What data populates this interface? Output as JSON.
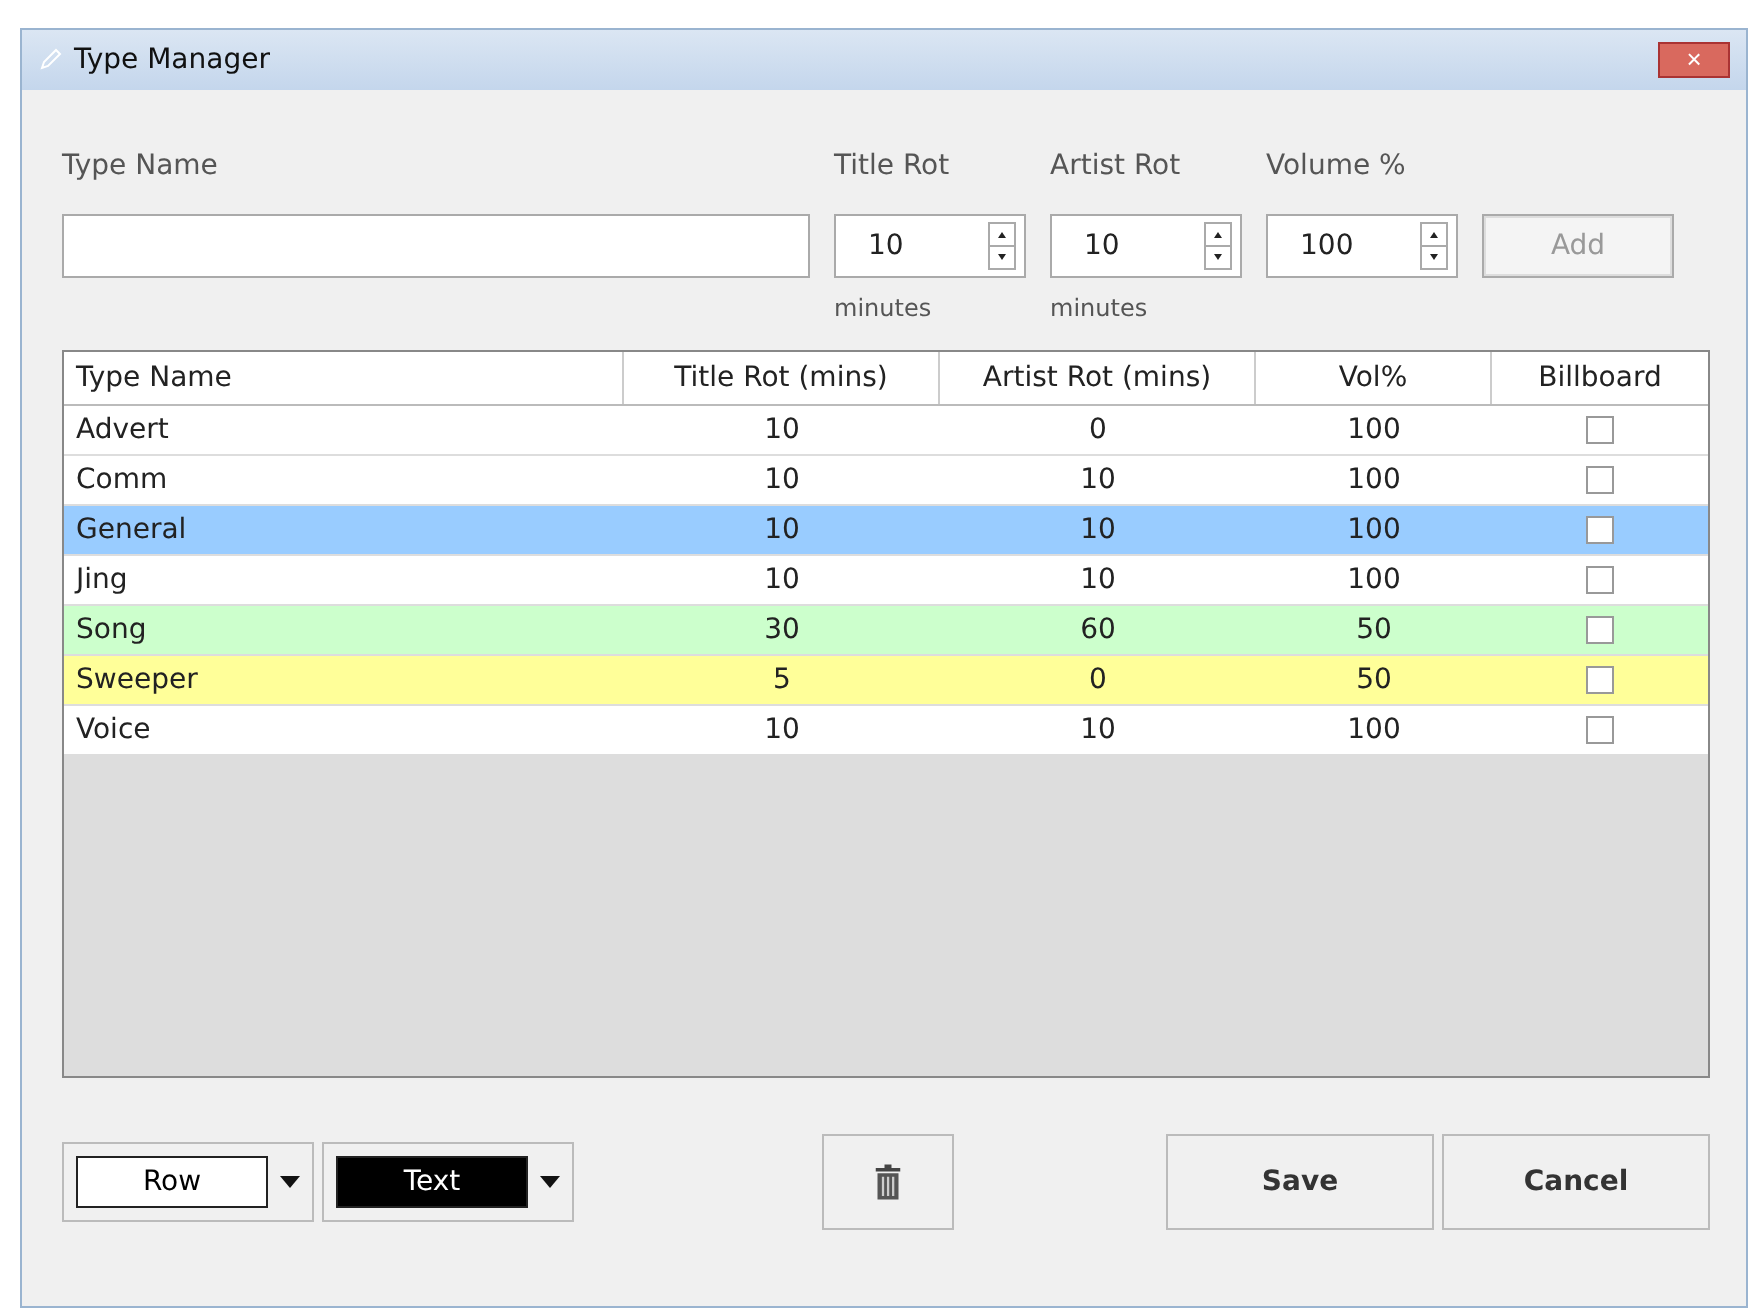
{
  "window": {
    "title": "Type Manager",
    "close": "×"
  },
  "form": {
    "type_name_label": "Type Name",
    "spinners": [
      {
        "label": "Title Rot",
        "value": "10",
        "unit": "minutes"
      },
      {
        "label": "Artist Rot",
        "value": "10",
        "unit": "minutes"
      },
      {
        "label": "Volume %",
        "value": "100"
      }
    ],
    "add_button": {
      "label": "Add",
      "disabled": true
    }
  },
  "table": {
    "columns": [
      "Type Name",
      "Title Rot (mins)",
      "Artist Rot (mins)",
      "Vol%",
      "Billboard"
    ],
    "rows": [
      {
        "name": "Advert",
        "title_rot": "10",
        "artist_rot": "0",
        "vol": "100",
        "billboard": false,
        "color": "#ffffff"
      },
      {
        "name": "Comm",
        "title_rot": "10",
        "artist_rot": "10",
        "vol": "100",
        "billboard": false,
        "color": "#ffffff"
      },
      {
        "name": "General",
        "title_rot": "10",
        "artist_rot": "10",
        "vol": "100",
        "billboard": false,
        "color": "#99ccff"
      },
      {
        "name": "Jing",
        "title_rot": "10",
        "artist_rot": "10",
        "vol": "100",
        "billboard": false,
        "color": "#ffffff"
      },
      {
        "name": "Song",
        "title_rot": "30",
        "artist_rot": "60",
        "vol": "50",
        "billboard": false,
        "color": "#ccffcc"
      },
      {
        "name": "Sweeper",
        "title_rot": "5",
        "artist_rot": "0",
        "vol": "50",
        "billboard": false,
        "color": "#ffff99"
      },
      {
        "name": "Voice",
        "title_rot": "10",
        "artist_rot": "10",
        "vol": "100",
        "billboard": false,
        "color": "#ffffff"
      }
    ]
  },
  "footer": {
    "pickers": [
      {
        "label": "Row",
        "color": "#ffffff"
      },
      {
        "label": "Text",
        "color": "#000000"
      }
    ],
    "buttons": [
      "Save",
      "Cancel"
    ]
  }
}
